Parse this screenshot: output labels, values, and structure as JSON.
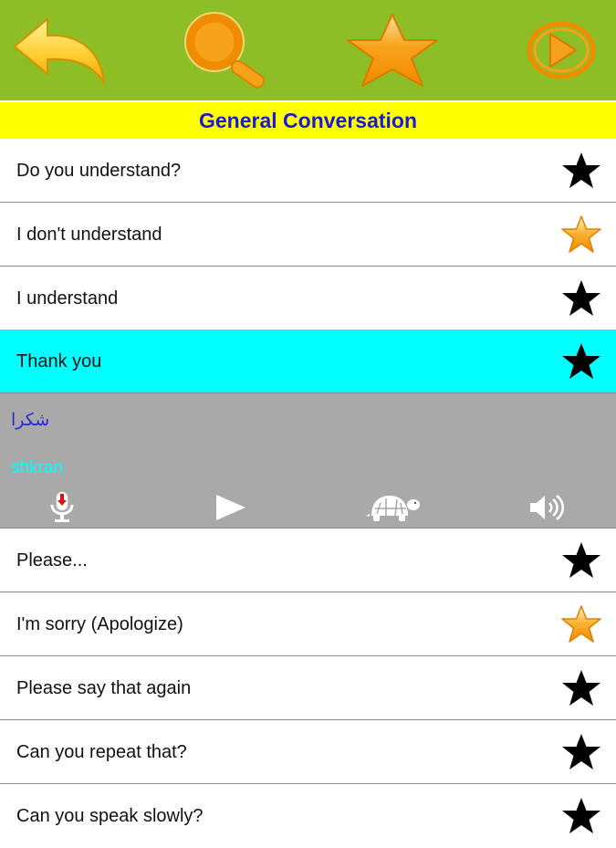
{
  "toolbar": {
    "buttons": [
      {
        "icon": "back-arrow-icon"
      },
      {
        "icon": "search-icon"
      },
      {
        "icon": "star-icon"
      },
      {
        "icon": "play-icon"
      }
    ],
    "bg_color": "#8dbe25"
  },
  "title": "General Conversation",
  "phrases": [
    {
      "text": "Do you understand?",
      "favorite": false
    },
    {
      "text": "I don't understand",
      "favorite": true
    },
    {
      "text": "I understand",
      "favorite": false
    },
    {
      "text": "Thank you",
      "favorite": false,
      "selected": true
    },
    {
      "text": "Please...",
      "favorite": false
    },
    {
      "text": "I'm sorry (Apologize)",
      "favorite": true
    },
    {
      "text": "Please say that again",
      "favorite": false
    },
    {
      "text": "Can you repeat that?",
      "favorite": false
    },
    {
      "text": "Can you speak slowly?",
      "favorite": false
    }
  ],
  "detail": {
    "arabic": "شكرا",
    "transliteration": "shkran",
    "controls": [
      "microphone-icon",
      "play-icon",
      "turtle-icon",
      "speaker-icon"
    ]
  },
  "colors": {
    "title_bg": "#ffff00",
    "title_text": "#1a1ad6",
    "selected_row": "#00ffff",
    "detail_bg": "#a9a9a9",
    "favorite_star": "#f7a21b"
  }
}
